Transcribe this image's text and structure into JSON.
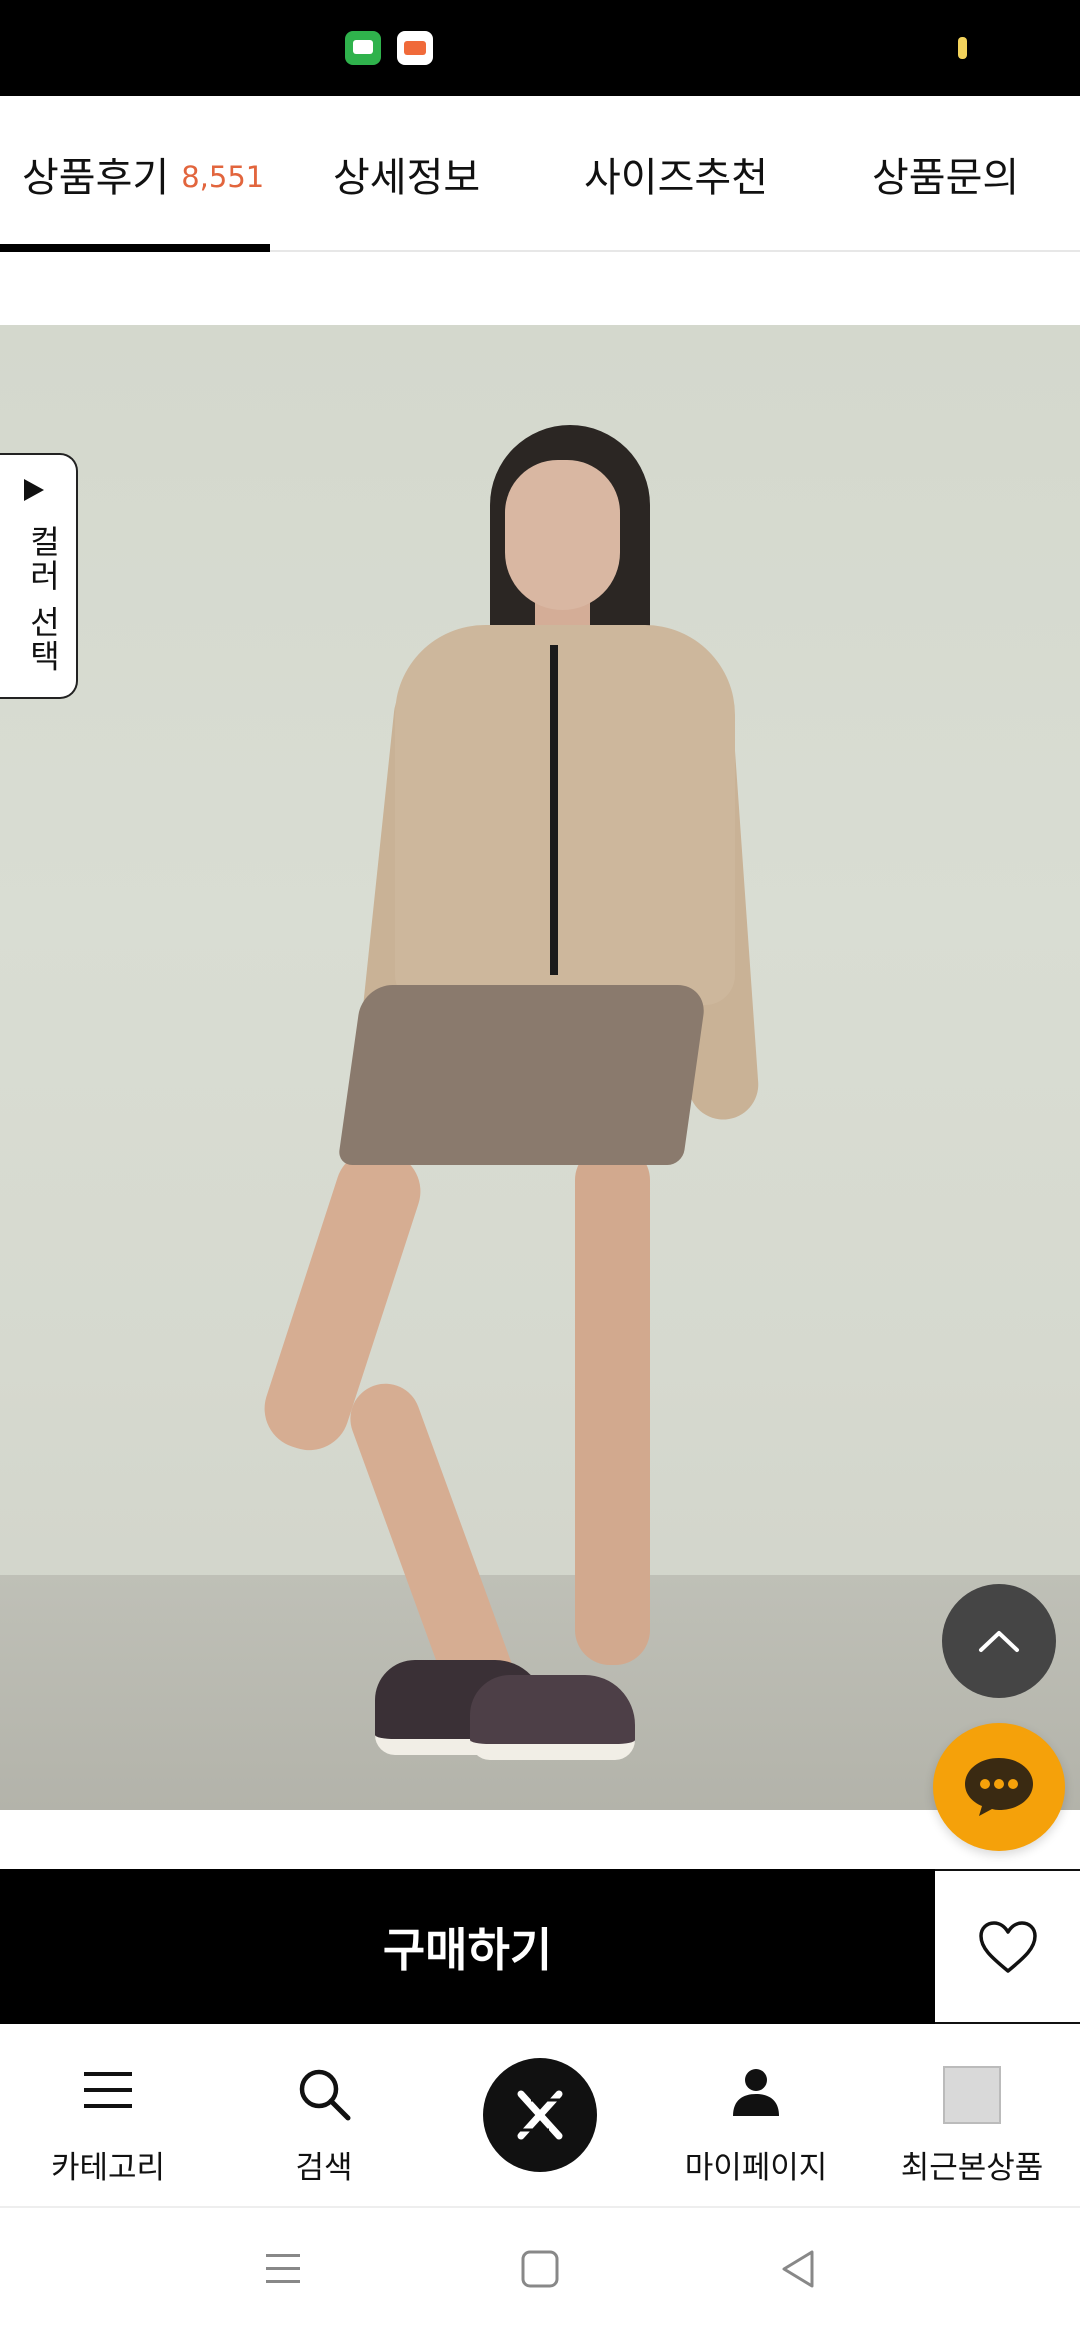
{
  "tabs": [
    {
      "label": "상품후기",
      "count": "8,551"
    },
    {
      "label": "상세정보"
    },
    {
      "label": "사이즈추천"
    },
    {
      "label": "상품문의"
    }
  ],
  "color_select": {
    "label": "컬러 선택"
  },
  "buy_bar": {
    "buy_label": "구매하기"
  },
  "bottom_nav": [
    {
      "label": "카테고리",
      "icon": "menu-icon"
    },
    {
      "label": "검색",
      "icon": "search-icon"
    },
    {
      "label": "",
      "icon": "brand-logo-icon"
    },
    {
      "label": "마이페이지",
      "icon": "person-icon"
    },
    {
      "label": "최근본상품",
      "icon": "recent-thumbnail"
    }
  ],
  "colors": {
    "accent": "#e2653d",
    "chat": "#f5a10a",
    "dark": "#000000"
  }
}
